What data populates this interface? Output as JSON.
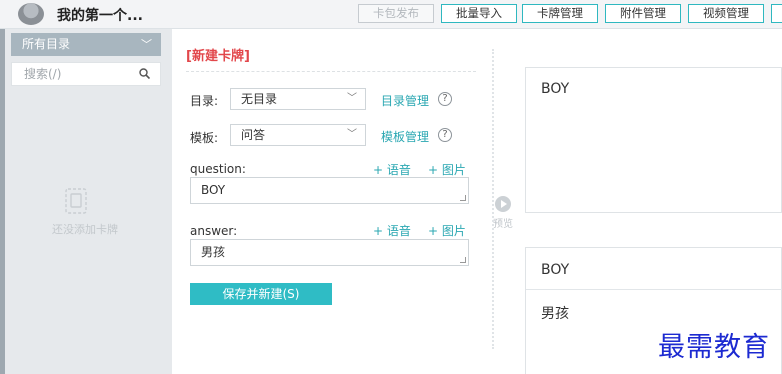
{
  "header": {
    "app_title": "我的第一个...",
    "buttons": [
      {
        "label": "卡包发布",
        "disabled": true
      },
      {
        "label": "批量导入"
      },
      {
        "label": "卡牌管理"
      },
      {
        "label": "附件管理"
      },
      {
        "label": "视频管理"
      }
    ]
  },
  "sidebar": {
    "dir_select": "所有目录",
    "search_placeholder": "搜索(/)",
    "empty_text": "还没添加卡牌"
  },
  "form": {
    "title": "[新建卡牌]",
    "dir_label": "目录:",
    "dir_value": "无目录",
    "dir_manage": "目录管理",
    "template_label": "模板:",
    "template_value": "问答",
    "template_manage": "模板管理",
    "help_glyph": "?",
    "question_label": "question:",
    "question_value": "BOY",
    "answer_label": "answer:",
    "answer_value": "男孩",
    "add_voice": "+ 语音",
    "add_image": "+ 图片",
    "save_button": "保存并新建(S)"
  },
  "preview": {
    "label": "预览",
    "front_text": "BOY",
    "back_question": "BOY",
    "back_answer": "男孩"
  },
  "watermark": "最需教育",
  "colors": {
    "accent": "#2fbcc5",
    "title_red": "#e2474b",
    "sidebar_bg": "#e6e9ec"
  }
}
